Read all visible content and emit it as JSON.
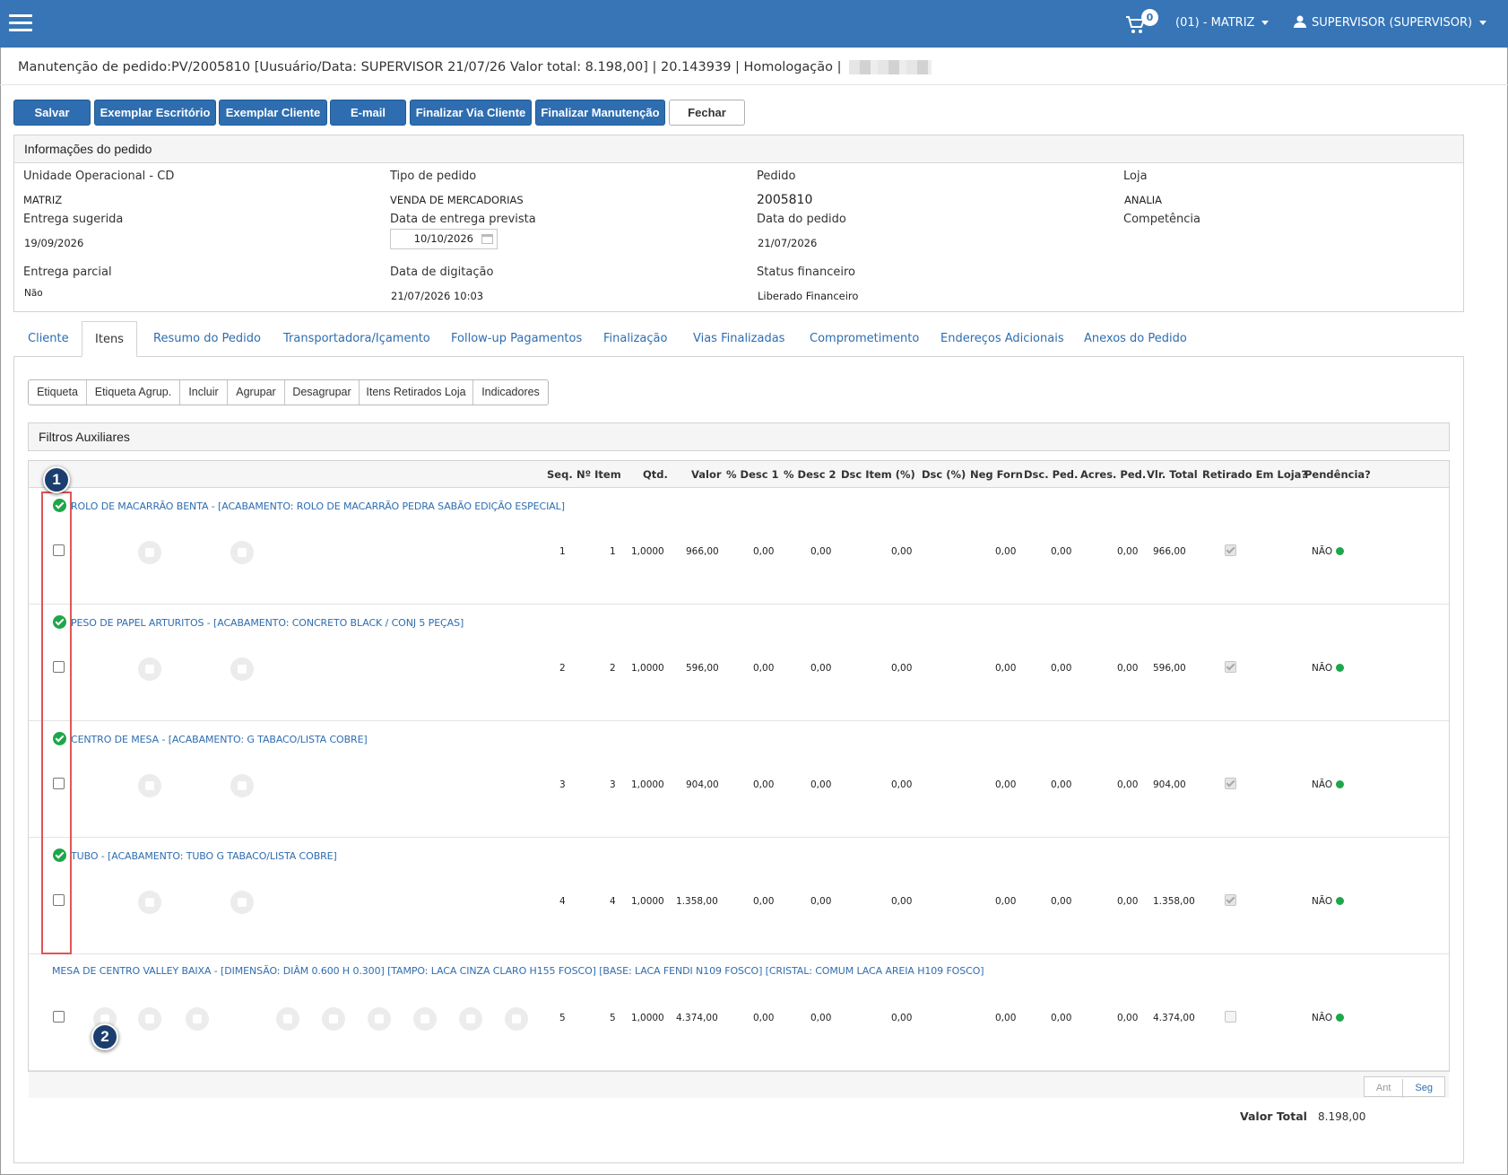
{
  "header": {
    "cart_count": "0",
    "unit": "(01) - MATRIZ",
    "user": "SUPERVISOR (SUPERVISOR)"
  },
  "page_title": "Manutenção de pedido:PV/2005810 [Uusuário/Data: SUPERVISOR 21/07/26 Valor total: 8.198,00] | 20.143939 | Homologação |",
  "toolbar": {
    "salvar": "Salvar",
    "exemplar_escritorio": "Exemplar Escritório",
    "exemplar_cliente": "Exemplar Cliente",
    "email": "E-mail",
    "finalizar_via_cliente": "Finalizar Via Cliente",
    "finalizar_manutencao": "Finalizar Manutenção",
    "fechar": "Fechar"
  },
  "info": {
    "title": "Informações do pedido",
    "unidade_label": "Unidade Operacional - CD",
    "unidade_value": "MATRIZ",
    "tipo_label": "Tipo de pedido",
    "tipo_value": "VENDA DE MERCADORIAS",
    "pedido_label": "Pedido",
    "pedido_value": "2005810",
    "loja_label": "Loja",
    "loja_value": "ANALIA",
    "entrega_sugerida_label": "Entrega sugerida",
    "entrega_sugerida_value": "19/09/2026",
    "data_entrega_prevista_label": "Data de entrega prevista",
    "data_entrega_prevista_value": "10/10/2026",
    "data_pedido_label": "Data do pedido",
    "data_pedido_value": "21/07/2026",
    "competencia_label": "Competência",
    "entrega_parcial_label": "Entrega parcial",
    "entrega_parcial_value": "Não",
    "data_digitacao_label": "Data de digitação",
    "data_digitacao_value": "21/07/2026 10:03",
    "status_fin_label": "Status financeiro",
    "status_fin_value": "Liberado Financeiro"
  },
  "tabs": [
    "Cliente",
    "Itens",
    "Resumo do Pedido",
    "Transportadora/Içamento",
    "Follow-up Pagamentos",
    "Finalização",
    "Vias Finalizadas",
    "Comprometimento",
    "Endereços Adicionais",
    "Anexos do Pedido"
  ],
  "subtoolbar": [
    "Etiqueta",
    "Etiqueta Agrup.",
    "Incluir",
    "Agrupar",
    "Desagrupar",
    "Itens Retirados Loja",
    "Indicadores"
  ],
  "filtros_title": "Filtros Auxiliares",
  "columns": {
    "seq": "Seq.",
    "n_item": "Nº Item",
    "qtd": "Qtd.",
    "valor": "Valor",
    "desc1": "% Desc 1",
    "desc2": "% Desc 2",
    "dsc_item": "Dsc Item (%)",
    "dsc": "Dsc (%)",
    "neg_forn": "Neg Forn",
    "dsc_ped": "Dsc. Ped.",
    "acres_ped": "Acres. Ped.",
    "vlr_total": "Vlr. Total",
    "retirado": "Retirado Em Loja?",
    "pendencia": "Pendência?"
  },
  "rows": [
    {
      "name": "ROLO DE MACARRÃO BENTA - [ACABAMENTO: ROLO DE MACARRÃO PEDRA SABÃO EDIÇÃO ESPECIAL]",
      "seq": "1",
      "item": "1",
      "qtd": "1,0000",
      "valor": "966,00",
      "desc1": "0,00",
      "desc2": "0,00",
      "dsc_item": "0,00",
      "dsc_ped": "0,00",
      "neg_forn": "0,00",
      "acres": "0,00",
      "total": "966,00",
      "pend": "NÃO"
    },
    {
      "name": "PESO DE PAPEL ARTURITOS - [ACABAMENTO: CONCRETO BLACK / CONJ 5 PEÇAS]",
      "seq": "2",
      "item": "2",
      "qtd": "1,0000",
      "valor": "596,00",
      "desc1": "0,00",
      "desc2": "0,00",
      "dsc_item": "0,00",
      "dsc_ped": "0,00",
      "neg_forn": "0,00",
      "acres": "0,00",
      "total": "596,00",
      "pend": "NÃO"
    },
    {
      "name": "CENTRO DE MESA - [ACABAMENTO: G TABACO/LISTA COBRE]",
      "seq": "3",
      "item": "3",
      "qtd": "1,0000",
      "valor": "904,00",
      "desc1": "0,00",
      "desc2": "0,00",
      "dsc_item": "0,00",
      "dsc_ped": "0,00",
      "neg_forn": "0,00",
      "acres": "0,00",
      "total": "904,00",
      "pend": "NÃO"
    },
    {
      "name": "TUBO - [ACABAMENTO: TUBO G TABACO/LISTA COBRE]",
      "seq": "4",
      "item": "4",
      "qtd": "1,0000",
      "valor": "1.358,00",
      "desc1": "0,00",
      "desc2": "0,00",
      "dsc_item": "0,00",
      "dsc_ped": "0,00",
      "neg_forn": "0,00",
      "acres": "0,00",
      "total": "1.358,00",
      "pend": "NÃO"
    },
    {
      "name": "MESA DE CENTRO VALLEY BAIXA - [DIMENSÃO: DIÂM 0.600 H 0.300] [TAMPO: LACA CINZA CLARO H155 FOSCO] [BASE: LACA FENDI N109 FOSCO] [CRISTAL: COMUM LACA AREIA H109 FOSCO]",
      "seq": "5",
      "item": "5",
      "qtd": "1,0000",
      "valor": "4.374,00",
      "desc1": "0,00",
      "desc2": "0,00",
      "dsc_item": "0,00",
      "dsc_ped": "0,00",
      "neg_forn": "0,00",
      "acres": "0,00",
      "total": "4.374,00",
      "pend": "NÃO"
    }
  ],
  "pager": {
    "prev": "Ant",
    "next": "Seg"
  },
  "valor_total_label": "Valor Total",
  "valor_total_value": "8.198,00",
  "callouts": [
    "1",
    "2"
  ]
}
